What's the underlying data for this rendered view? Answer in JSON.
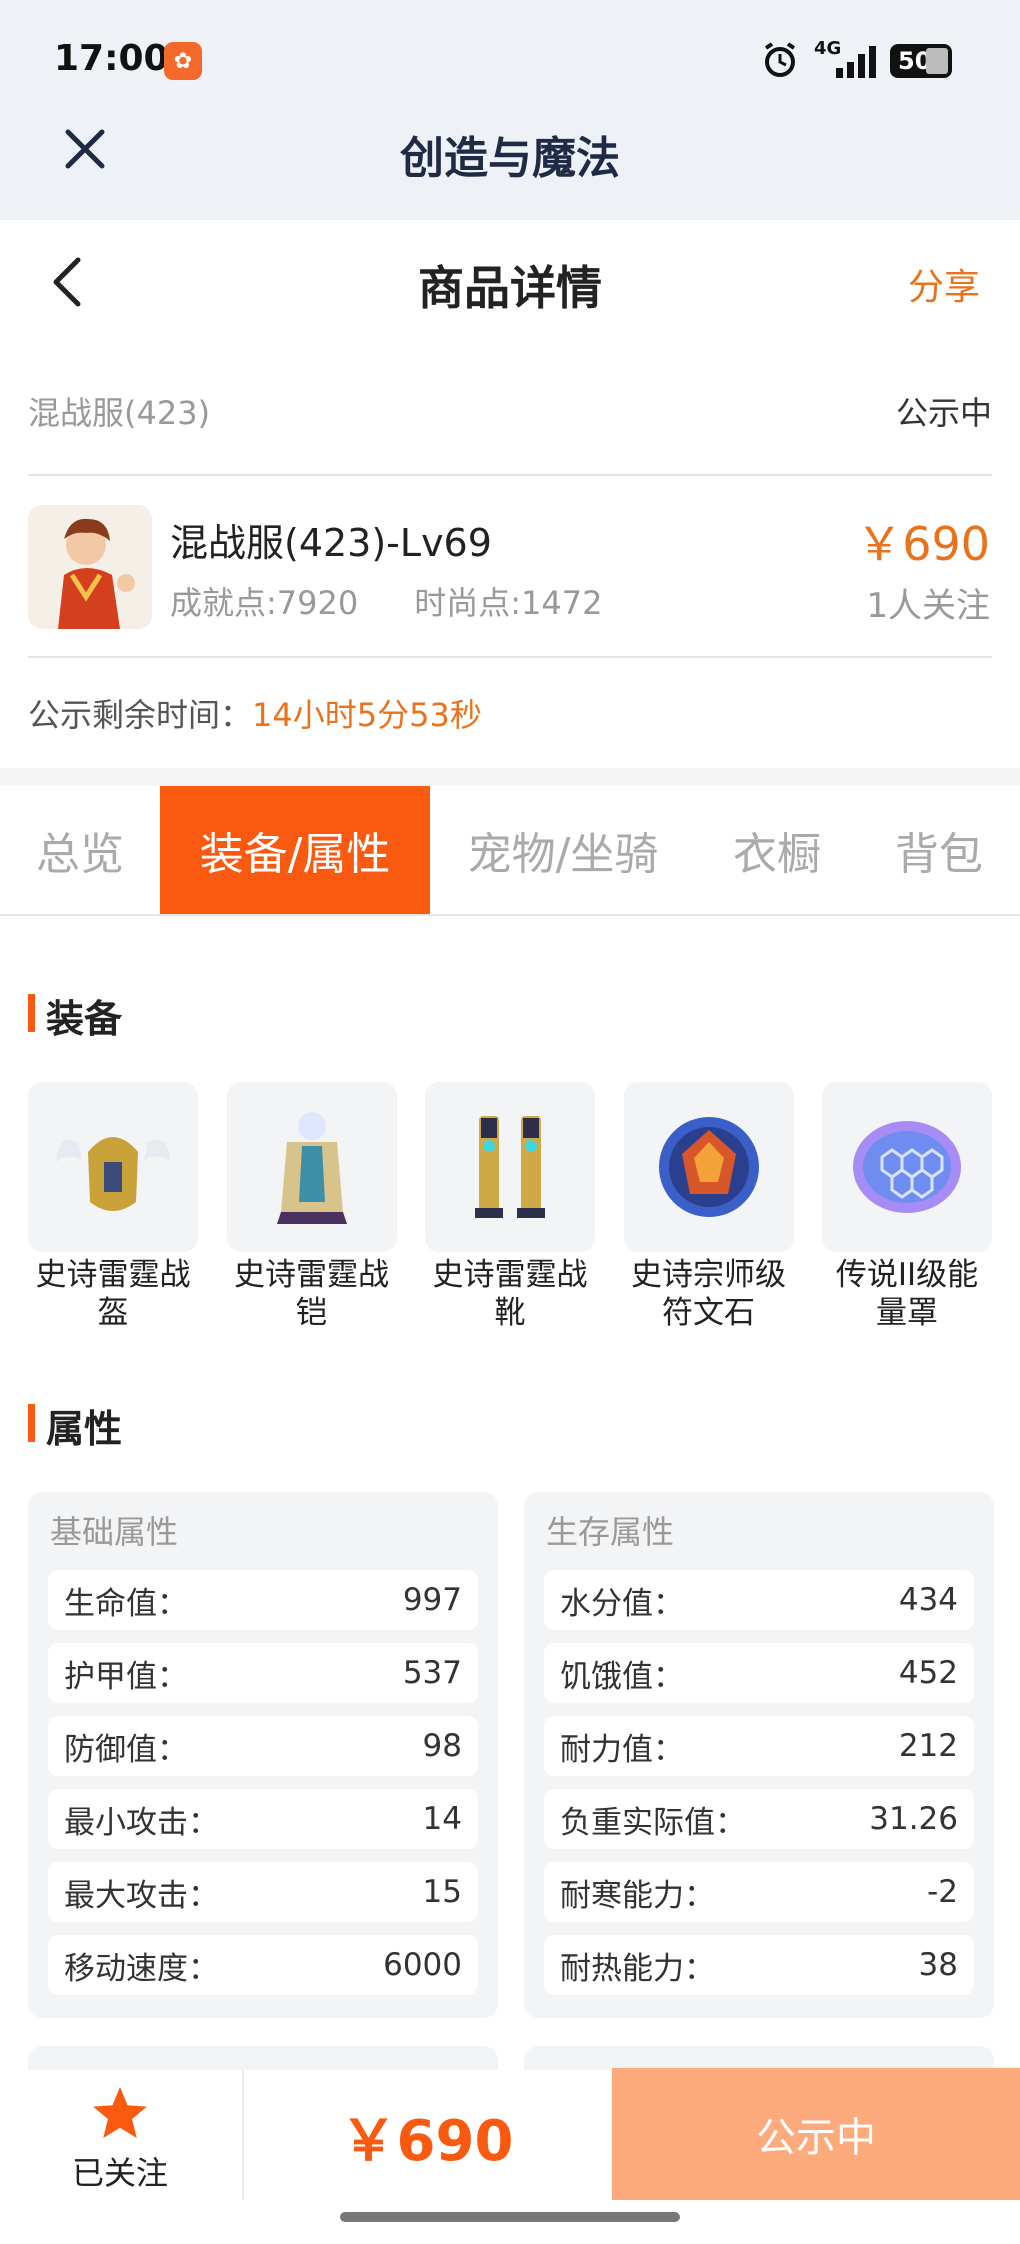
{
  "status_bar": {
    "time": "17:00",
    "network": "4G",
    "battery": "50",
    "icons": [
      "app-notification-icon",
      "alarm-icon",
      "signal-icon",
      "battery-icon"
    ]
  },
  "app_bar": {
    "title": "创造与魔法",
    "close_icon": "close-icon"
  },
  "header": {
    "title": "商品详情",
    "share_label": "分享",
    "back_icon": "chevron-left-icon"
  },
  "listing": {
    "server": "混战服(423)",
    "status": "公示中",
    "name": "混战服(423)-Lv69",
    "achievement": "成就点:7920",
    "fashion": "时尚点:1472",
    "price": "￥690",
    "followers": "1人关注",
    "countdown_label": "公示剩余时间：",
    "countdown_value": "14小时5分53秒"
  },
  "tabs": [
    {
      "label": "总览",
      "active": false
    },
    {
      "label": "装备/属性",
      "active": true
    },
    {
      "label": "宠物/坐骑",
      "active": false
    },
    {
      "label": "衣橱",
      "active": false
    },
    {
      "label": "背包",
      "active": false
    }
  ],
  "equipment": {
    "section_title": "装备",
    "items": [
      {
        "label": "史诗雷霆战盔",
        "icon": "helmet-icon"
      },
      {
        "label": "史诗雷霆战铠",
        "icon": "armor-icon"
      },
      {
        "label": "史诗雷霆战靴",
        "icon": "boots-icon"
      },
      {
        "label": "史诗宗师级符文石",
        "icon": "rune-stone-icon"
      },
      {
        "label": "传说II级能量罩",
        "icon": "energy-shield-icon"
      }
    ]
  },
  "attributes": {
    "section_title": "属性",
    "basic": {
      "title": "基础属性",
      "rows": [
        {
          "name": "生命值：",
          "value": "997"
        },
        {
          "name": "护甲值：",
          "value": "537"
        },
        {
          "name": "防御值：",
          "value": "98"
        },
        {
          "name": "最小攻击：",
          "value": "14"
        },
        {
          "name": "最大攻击：",
          "value": "15"
        },
        {
          "name": "移动速度：",
          "value": "6000"
        }
      ]
    },
    "survival": {
      "title": "生存属性",
      "rows": [
        {
          "name": "水分值：",
          "value": "434"
        },
        {
          "name": "饥饿值：",
          "value": "452"
        },
        {
          "name": "耐力值：",
          "value": "212"
        },
        {
          "name": "负重实际值：",
          "value": "31.26"
        },
        {
          "name": "耐寒能力：",
          "value": "-2"
        },
        {
          "name": "耐热能力：",
          "value": "38"
        }
      ]
    }
  },
  "bottom_bar": {
    "follow_label": "已关注",
    "follow_icon": "star-icon",
    "price": "￥690",
    "status_button": "公示中"
  },
  "colors": {
    "accent": "#fa5a0f",
    "price": "#e8731c",
    "status_button": "#fdaa7c"
  }
}
